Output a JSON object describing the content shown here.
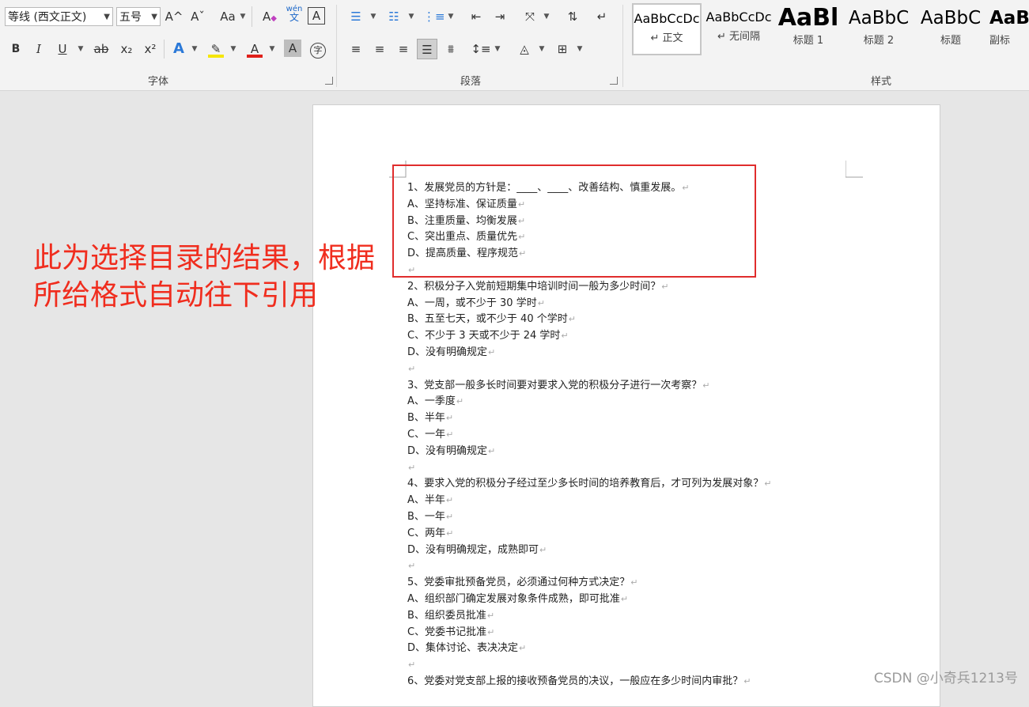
{
  "ribbon": {
    "font": {
      "font_name": "等线 (西文正文)",
      "font_size": "五号",
      "group_label": "字体",
      "grow_icon": "A^",
      "shrink_icon": "Aˇ",
      "case_icon": "Aa",
      "clear_icon": "A",
      "phonetic_top": "wén",
      "phonetic_bottom": "文",
      "border_icon": "A",
      "bold": "B",
      "italic": "I",
      "underline": "U",
      "strike": "ab",
      "subscript": "x₂",
      "superscript": "x²",
      "effects": "A",
      "highlight_color": "#f5e60a",
      "font_color": "#e0201b",
      "font_color_letter": "A",
      "shading_letter": "A",
      "enclose": "字"
    },
    "paragraph": {
      "group_label": "段落"
    },
    "styles": {
      "group_label": "样式",
      "items": [
        {
          "sample": "AaBbCcDc",
          "name": "↵ 正文"
        },
        {
          "sample": "AaBbCcDc",
          "name": "↵ 无间隔"
        },
        {
          "sample": "AaBl",
          "name": "标题 1"
        },
        {
          "sample": "AaBbC",
          "name": "标题 2"
        },
        {
          "sample": "AaBbC",
          "name": "标题"
        },
        {
          "sample": "AaB",
          "name": "副标"
        }
      ]
    }
  },
  "document": {
    "lines": [
      "1、发展党员的方针是：____、____、改善结构、慎重发展。",
      "A、坚持标准、保证质量",
      "B、注重质量、均衡发展",
      "C、突出重点、质量优先",
      "D、提高质量、程序规范",
      "",
      "2、积极分子入党前短期集中培训时间一般为多少时间？",
      "A、一周，或不少于 30 学时",
      "B、五至七天，或不少于 40 个学时",
      "C、不少于 3 天或不少于 24 学时",
      "D、没有明确规定",
      "",
      "3、党支部一般多长时间要对要求入党的积极分子进行一次考察？",
      "A、一季度",
      "B、半年",
      "C、一年",
      "D、没有明确规定",
      "",
      "4、要求入党的积极分子经过至少多长时间的培养教育后，才可列为发展对象？",
      "A、半年",
      "B、一年",
      "C、两年",
      "D、没有明确规定，成熟即可",
      "",
      "5、党委审批预备党员，必须通过何种方式决定？",
      "A、组织部门确定发展对象条件成熟，即可批准",
      "B、组织委员批准",
      "C、党委书记批准",
      "D、集体讨论、表决决定",
      "",
      "6、党委对党支部上报的接收预备党员的决议，一般应在多少时间内审批？"
    ],
    "paragraph_mark": "↵"
  },
  "annotation": {
    "text": "此为选择目录的结果，根据所给格式自动往下引用",
    "color": "#f02d1e"
  },
  "watermark": "CSDN @小奇兵1213号"
}
